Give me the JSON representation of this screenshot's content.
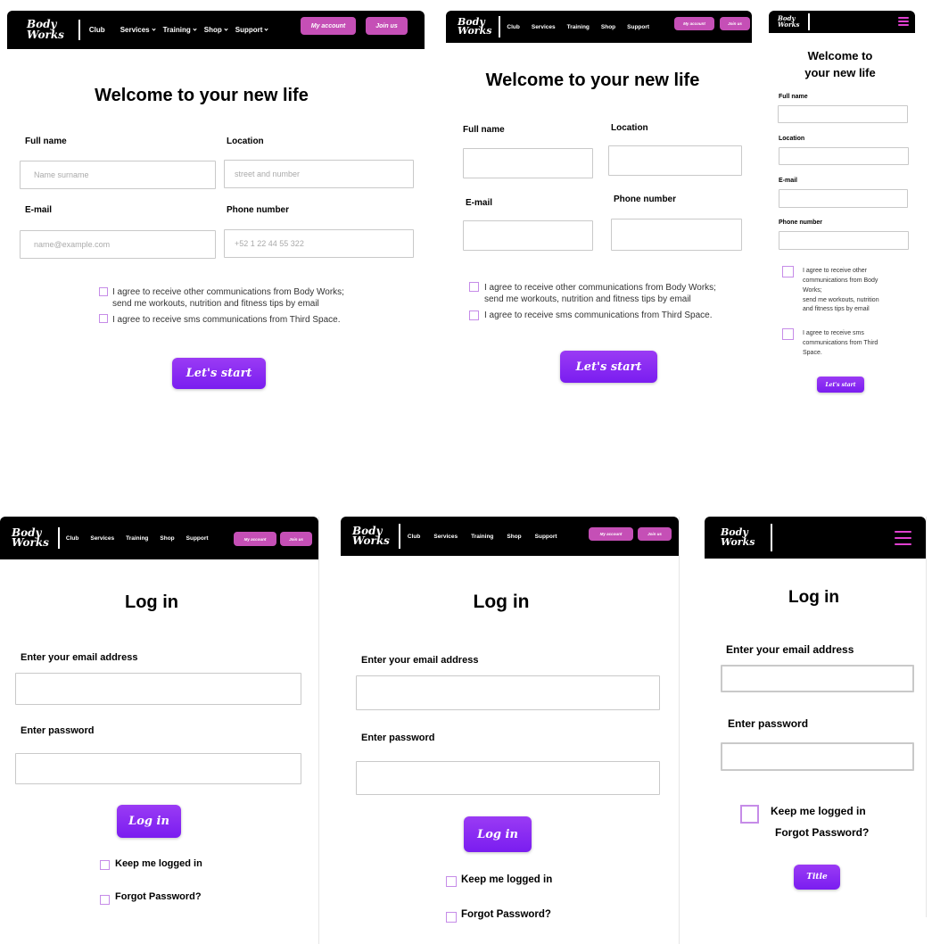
{
  "brand": {
    "line1": "Body",
    "line2": "Works"
  },
  "nav": {
    "club": "Club",
    "services": "Services",
    "training": "Training",
    "shop": "Shop",
    "support": "Support",
    "my_account": "My account",
    "join_us": "Join us"
  },
  "signup": {
    "title": "Welcome to your new life",
    "title_mobile_line1": "Welcome to",
    "title_mobile_line2": "your new life",
    "full_name_label": "Full name",
    "full_name_placeholder": "Name surname",
    "location_label": "Location",
    "location_placeholder": "street and number",
    "email_label": "E-mail",
    "email_placeholder": "name@example.com",
    "phone_label": "Phone number",
    "phone_placeholder": "+52 1 22 44 55 322",
    "consent_comms_line1": "I agree to receive other communications from Body Works;",
    "consent_comms_line2": "send me workouts, nutrition and fitness tips by email",
    "consent_sms": "I agree to receive sms communications from Third Space.",
    "mobile_comms_lines": [
      "I agree to receive other",
      "communications from Body",
      "Works;",
      "send me workouts, nutrition",
      "and fitness tips by email"
    ],
    "mobile_sms_lines": [
      "I agree to receive sms",
      "communications from Third",
      "Space."
    ],
    "submit": "Let's start"
  },
  "login": {
    "title": "Log in",
    "email_label": "Enter your email address",
    "password_label": "Enter password",
    "submit": "Log in",
    "keep_logged": "Keep me logged in",
    "forgot": "Forgot Password?",
    "mobile_submit": "Title"
  },
  "colors": {
    "accent_purple": "#7a1df0",
    "nav_button": "#c54fb6",
    "checkbox_border": "#c68ce8",
    "hamburger": "#e040d0"
  }
}
